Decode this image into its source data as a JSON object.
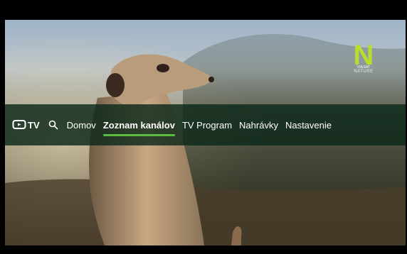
{
  "channel_logo": {
    "letter": "N",
    "brand": "VIASAT",
    "subtitle": "NATURE",
    "color": "#b8dd2f"
  },
  "nav": {
    "app_logo_text": "TV",
    "search_icon": "search-icon",
    "items": [
      {
        "label": "Domov",
        "active": false
      },
      {
        "label": "Zoznam kanálov",
        "active": true
      },
      {
        "label": "TV Program",
        "active": false
      },
      {
        "label": "Nahrávky",
        "active": false
      },
      {
        "label": "Nastavenie",
        "active": false
      }
    ],
    "accent_color": "#5dbb42"
  }
}
